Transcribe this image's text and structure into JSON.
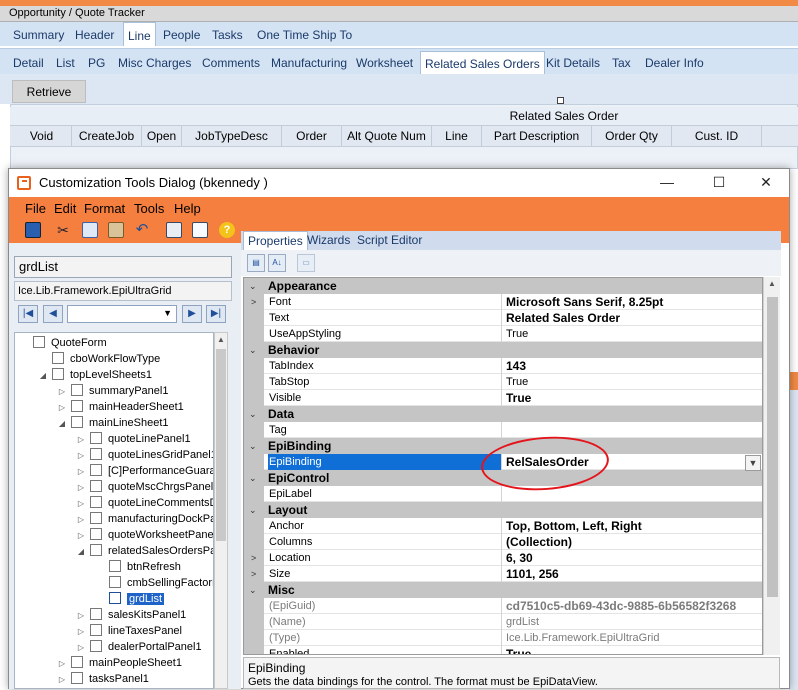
{
  "app": {
    "title": "Opportunity / Quote Tracker",
    "top_tabs": [
      "Summary",
      "Header",
      "Line",
      "People",
      "Tasks",
      "One Time Ship To"
    ],
    "active_top_tab": "Line",
    "line_tabs": [
      "Detail",
      "List",
      "PG",
      "Misc Charges",
      "Comments",
      "Manufacturing",
      "Worksheet",
      "Related Sales Orders",
      "Kit Details",
      "Tax",
      "Dealer Info"
    ],
    "active_line_tab": "Related Sales Orders",
    "retrieve_label": "Retrieve",
    "grid_group_label": "Related Sales Order",
    "grid_columns": [
      "Void",
      "CreateJob",
      "Open",
      "JobTypeDesc",
      "Order",
      "Alt Quote Num",
      "Line",
      "Part Description",
      "Order Qty",
      "Cust. ID"
    ]
  },
  "dialog": {
    "title": "Customization Tools Dialog  (bkennedy )",
    "window_buttons": [
      "—",
      "☐",
      "✕"
    ],
    "menu": [
      "File",
      "Edit",
      "Format",
      "Tools",
      "Help"
    ],
    "toolbar_icons": [
      "save-icon",
      "cut-icon",
      "copy-icon",
      "paste-icon",
      "undo-icon",
      "print-icon",
      "print-preview-icon",
      "help-icon"
    ],
    "selected_control": "grdList",
    "selected_type": "Ice.Lib.Framework.EpiUltraGrid",
    "nav_buttons": [
      "|◀",
      "◀",
      "▶",
      "▶|"
    ],
    "tree": [
      {
        "label": "QuoteForm",
        "level": 0,
        "expander": ""
      },
      {
        "label": "cboWorkFlowType",
        "level": 1,
        "expander": ""
      },
      {
        "label": "topLevelSheets1",
        "level": 1,
        "expander": "◢"
      },
      {
        "label": "summaryPanel1",
        "level": 2,
        "expander": "▷"
      },
      {
        "label": "mainHeaderSheet1",
        "level": 2,
        "expander": "▷"
      },
      {
        "label": "mainLineSheet1",
        "level": 2,
        "expander": "◢"
      },
      {
        "label": "quoteLinePanel1",
        "level": 3,
        "expander": "▷"
      },
      {
        "label": "quoteLinesGridPanel1",
        "level": 3,
        "expander": "▷"
      },
      {
        "label": "[C]PerformanceGuara",
        "level": 3,
        "expander": "▷"
      },
      {
        "label": "quoteMscChrgsPanel1",
        "level": 3,
        "expander": "▷"
      },
      {
        "label": "quoteLineCommentsD",
        "level": 3,
        "expander": "▷"
      },
      {
        "label": "manufacturingDockPa",
        "level": 3,
        "expander": "▷"
      },
      {
        "label": "quoteWorksheetPanel",
        "level": 3,
        "expander": "▷"
      },
      {
        "label": "relatedSalesOrdersPa",
        "level": 3,
        "expander": "◢"
      },
      {
        "label": "btnRefresh",
        "level": 4,
        "expander": ""
      },
      {
        "label": "cmbSellingFactorD",
        "level": 4,
        "expander": ""
      },
      {
        "label": "grdList",
        "level": 4,
        "expander": "",
        "selected": true
      },
      {
        "label": "salesKitsPanel1",
        "level": 3,
        "expander": "▷"
      },
      {
        "label": "lineTaxesPanel",
        "level": 3,
        "expander": "▷"
      },
      {
        "label": "dealerPortalPanel1",
        "level": 3,
        "expander": "▷"
      },
      {
        "label": "mainPeopleSheet1",
        "level": 2,
        "expander": "▷"
      },
      {
        "label": "tasksPanel1",
        "level": 2,
        "expander": "▷"
      }
    ],
    "right_tabs": [
      "Properties",
      "Wizards",
      "Script Editor"
    ],
    "active_right_tab": "Properties",
    "properties": [
      {
        "category": "Appearance",
        "rows": [
          {
            "name": "Font",
            "value": "Microsoft Sans Serif, 8.25pt",
            "bold": true,
            "expander": ">"
          },
          {
            "name": "Text",
            "value": "Related Sales Order",
            "bold": true
          },
          {
            "name": "UseAppStyling",
            "value": "True"
          }
        ]
      },
      {
        "category": "Behavior",
        "rows": [
          {
            "name": "TabIndex",
            "value": "143",
            "bold": true
          },
          {
            "name": "TabStop",
            "value": "True"
          },
          {
            "name": "Visible",
            "value": "True",
            "bold": true
          }
        ]
      },
      {
        "category": "Data",
        "rows": [
          {
            "name": "Tag",
            "value": ""
          }
        ]
      },
      {
        "category": "EpiBinding",
        "rows": [
          {
            "name": "EpiBinding",
            "value": "RelSalesOrder",
            "bold": true,
            "selected": true
          }
        ]
      },
      {
        "category": "EpiControl",
        "rows": [
          {
            "name": "EpiLabel",
            "value": ""
          }
        ]
      },
      {
        "category": "Layout",
        "rows": [
          {
            "name": "Anchor",
            "value": "Top, Bottom, Left, Right",
            "bold": true
          },
          {
            "name": "Columns",
            "value": "(Collection)",
            "bold": true
          },
          {
            "name": "Location",
            "value": "6, 30",
            "bold": true,
            "expander": ">"
          },
          {
            "name": "Size",
            "value": "1101, 256",
            "bold": true,
            "expander": ">"
          }
        ]
      },
      {
        "category": "Misc",
        "rows": [
          {
            "name": "(EpiGuid)",
            "value": "cd7510c5-db69-43dc-9885-6b56582f3268",
            "bold": true,
            "grey": true
          },
          {
            "name": "(Name)",
            "value": "grdList",
            "grey": true
          },
          {
            "name": "(Type)",
            "value": "Ice.Lib.Framework.EpiUltraGrid",
            "grey": true
          },
          {
            "name": "Enabled",
            "value": "True",
            "bold": true
          }
        ]
      }
    ],
    "description_title": "EpiBinding",
    "description_text": "Gets the data bindings for the control. The format must be EpiDataView."
  }
}
